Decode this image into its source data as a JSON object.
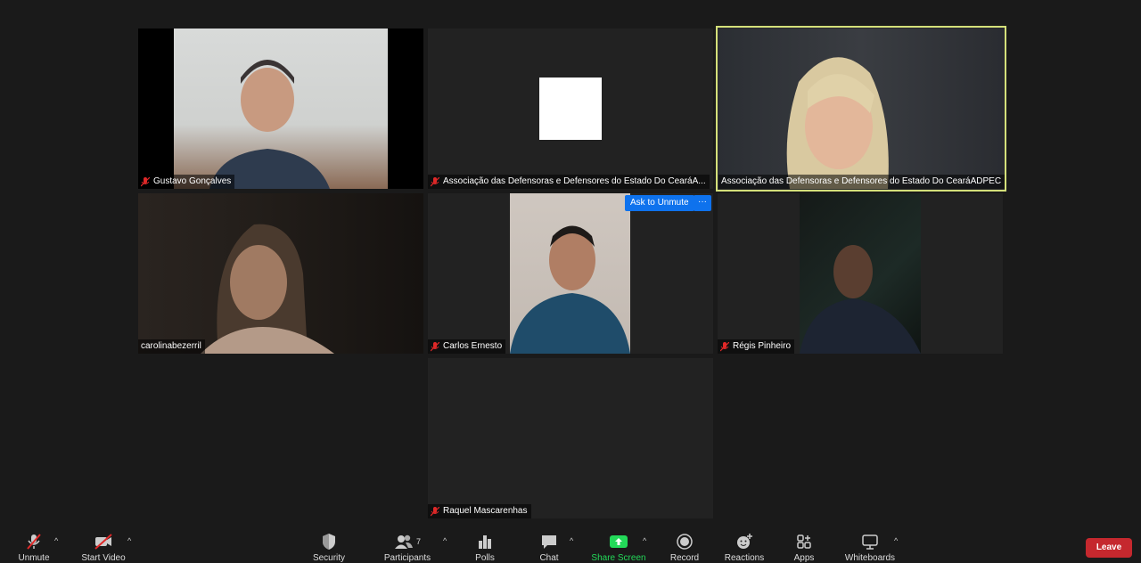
{
  "participants": [
    {
      "name": "Gustavo Gonçalves",
      "muted": true
    },
    {
      "name": "Associação das Defensoras e Defensores do Estado Do CearáA...",
      "muted": true
    },
    {
      "name": "Associação das Defensoras e Defensores do Estado Do CearáADPEC",
      "muted": false,
      "active_speaker": true
    },
    {
      "name": "carolinabezerril",
      "muted": false
    },
    {
      "name": "Carlos Ernesto",
      "muted": true
    },
    {
      "name": "Régis Pinheiro",
      "muted": true
    },
    {
      "name": "Raquel Mascarenhas",
      "muted": true
    }
  ],
  "hover_controls": {
    "ask_to_unmute": "Ask to Unmute",
    "more": "···"
  },
  "toolbar": {
    "unmute": "Unmute",
    "start_video": "Start Video",
    "security": "Security",
    "participants": "Participants",
    "participants_count": "7",
    "polls": "Polls",
    "chat": "Chat",
    "share_screen": "Share Screen",
    "record": "Record",
    "reactions": "Reactions",
    "apps": "Apps",
    "whiteboards": "Whiteboards",
    "leave": "Leave"
  },
  "colors": {
    "active_speaker_border": "#d4e07a",
    "share_screen_green": "#23d959",
    "leave_red": "#c5282e",
    "muted_red": "#e02828",
    "button_blue": "#0e72ed"
  }
}
